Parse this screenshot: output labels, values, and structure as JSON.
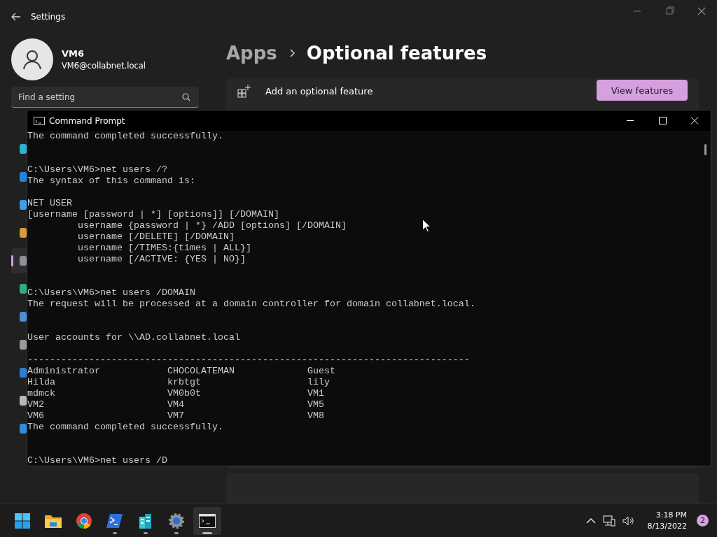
{
  "settings": {
    "title": "Settings",
    "user": {
      "name": "VM6",
      "email": "VM6@collabnet.local"
    },
    "search": {
      "placeholder": "Find a setting"
    },
    "sidebar": {
      "items": [
        {
          "color": "#2bb3d6",
          "selected": false
        },
        {
          "color": "#1f86e0",
          "selected": false
        },
        {
          "color": "#3a9ee8",
          "selected": false
        },
        {
          "color": "#d99a3a",
          "selected": false
        },
        {
          "color": "#8a8f98",
          "selected": true
        },
        {
          "color": "#2fae7a",
          "selected": false
        },
        {
          "color": "#4a8fd8",
          "selected": false
        },
        {
          "color": "#9a9a9a",
          "selected": false
        },
        {
          "color": "#2a7fd4",
          "selected": false
        },
        {
          "color": "#b8b8b8",
          "selected": false
        },
        {
          "color": "#2d8fe0",
          "selected": false
        }
      ]
    },
    "breadcrumb": [
      "Apps",
      "Optional features"
    ],
    "card": {
      "label": "Add an optional feature",
      "button": "View features"
    }
  },
  "console": {
    "title": "Command Prompt",
    "lines": [
      {
        "kind": "text",
        "text": "The command completed successfully."
      },
      {
        "kind": "blank"
      },
      {
        "kind": "blank"
      },
      {
        "kind": "text",
        "text": "C:\\Users\\VM6>net users /?"
      },
      {
        "kind": "text",
        "text": "The syntax of this command is:"
      },
      {
        "kind": "blank"
      },
      {
        "kind": "text",
        "text": "NET USER"
      },
      {
        "kind": "text",
        "text": "[username [password | *] [options]] [/DOMAIN]"
      },
      {
        "kind": "indented",
        "text": "username {password | *} /ADD [options] [/DOMAIN]"
      },
      {
        "kind": "indented",
        "text": "username [/DELETE] [/DOMAIN]"
      },
      {
        "kind": "indented",
        "text": "username [/TIMES:{times | ALL}]"
      },
      {
        "kind": "indented",
        "text": "username [/ACTIVE: {YES | NO}]"
      },
      {
        "kind": "blank"
      },
      {
        "kind": "blank"
      },
      {
        "kind": "text",
        "text": "C:\\Users\\VM6>net users /DOMAIN"
      },
      {
        "kind": "text",
        "text": "The request will be processed at a domain controller for domain collabnet.local."
      },
      {
        "kind": "blank"
      },
      {
        "kind": "blank"
      },
      {
        "kind": "text",
        "text": "User accounts for \\\\AD.collabnet.local"
      },
      {
        "kind": "blank"
      },
      {
        "kind": "text",
        "text": "-------------------------------------------------------------------------------"
      },
      {
        "kind": "row",
        "cells": [
          "Administrator",
          "CHOCOLATEMAN",
          "Guest"
        ]
      },
      {
        "kind": "row",
        "cells": [
          "Hilda",
          "krbtgt",
          "lily"
        ]
      },
      {
        "kind": "row",
        "cells": [
          "mdmck",
          "VM0b0t",
          "VM1"
        ]
      },
      {
        "kind": "row",
        "cells": [
          "VM2",
          "VM4",
          "VM5"
        ]
      },
      {
        "kind": "row",
        "cells": [
          "VM6",
          "VM7",
          "VM8"
        ]
      },
      {
        "kind": "text",
        "text": "The command completed successfully."
      },
      {
        "kind": "blank"
      },
      {
        "kind": "blank"
      },
      {
        "kind": "text",
        "text": "C:\\Users\\VM6>net users /D"
      }
    ]
  },
  "taskbar": {
    "apps": [
      {
        "kind": "start",
        "running": false,
        "selected": false
      },
      {
        "kind": "folder",
        "running": false,
        "selected": false
      },
      {
        "kind": "browser",
        "running": false,
        "selected": false
      },
      {
        "kind": "shell",
        "running": true,
        "selected": false
      },
      {
        "kind": "buildings",
        "running": true,
        "selected": false
      },
      {
        "kind": "gear",
        "running": true,
        "selected": false
      },
      {
        "kind": "console",
        "running": true,
        "selected": true
      }
    ],
    "tray": {
      "time": "3:18 PM",
      "date": "8/13/2022",
      "badge": "2"
    }
  }
}
